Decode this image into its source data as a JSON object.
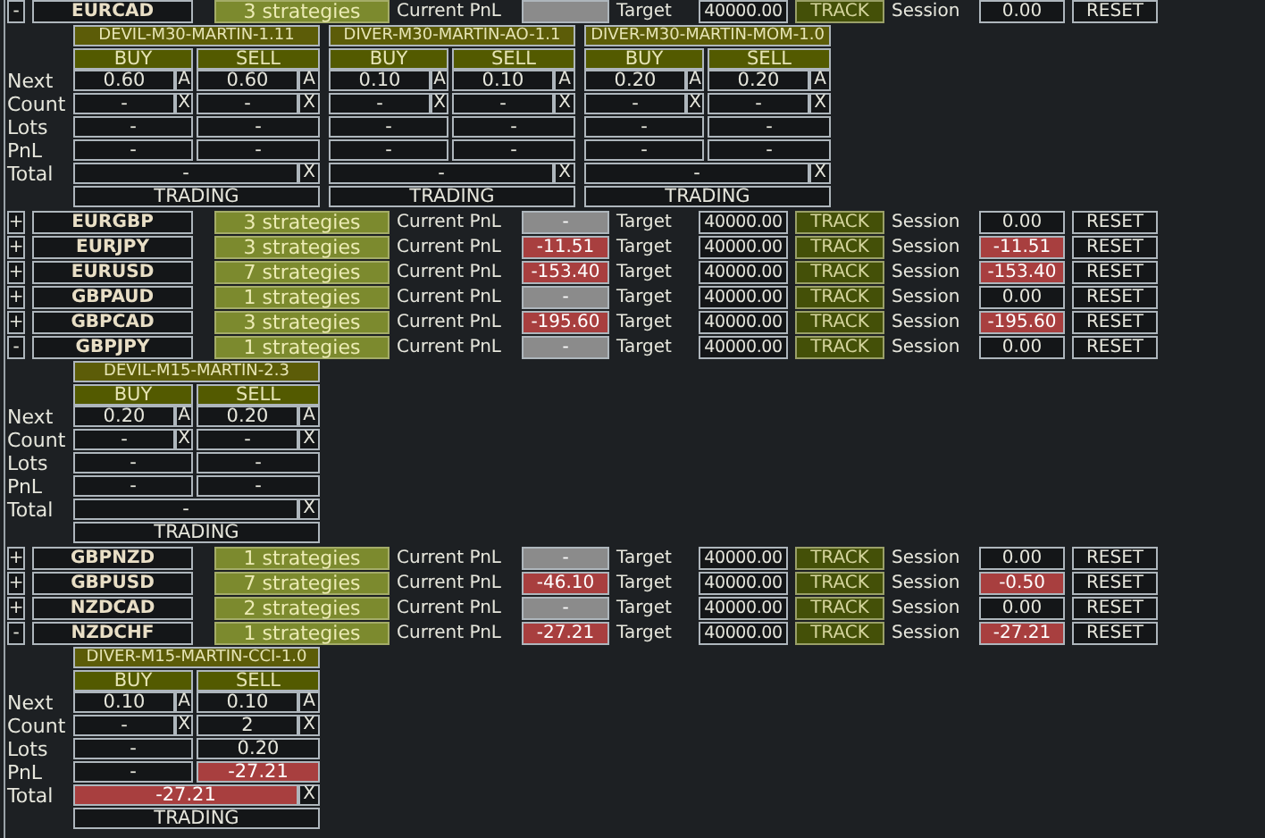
{
  "pairs": [
    {
      "toggle": "-",
      "symbol": "EURCAD",
      "strategies": "3 strategies",
      "pnl_label": "Current PnL",
      "pnl": {
        "loss": false
      },
      "target_label": "Target",
      "target": "40000.00",
      "track": "TRACK",
      "session_label": "Session",
      "session": {
        "text": "0.00",
        "loss": false
      },
      "reset": "RESET",
      "detail": {
        "row_labels": [
          "Next",
          "Count",
          "Lots",
          "PnL",
          "Total"
        ],
        "strategies": [
          {
            "name": "DEVIL-M30-MARTIN-1.11",
            "sides": [
              {
                "label": "BUY",
                "next": "0.60",
                "auto": "A",
                "count": "-",
                "close": "X",
                "lots": "-",
                "pnl": {
                  "text": "-",
                  "loss": false
                }
              },
              {
                "label": "SELL",
                "next": "0.60",
                "auto": "A",
                "count": "-",
                "close": "X",
                "lots": "-",
                "pnl": {
                  "text": "-",
                  "loss": false
                }
              }
            ],
            "total": {
              "text": "-",
              "loss": false
            },
            "total_close": "X",
            "status": "TRADING"
          },
          {
            "name": "DIVER-M30-MARTIN-AO-1.1",
            "sides": [
              {
                "label": "BUY",
                "next": "0.10",
                "auto": "A",
                "count": "-",
                "close": "X",
                "lots": "-",
                "pnl": {
                  "text": "-",
                  "loss": false
                }
              },
              {
                "label": "SELL",
                "next": "0.10",
                "auto": "A",
                "count": "-",
                "close": "X",
                "lots": "-",
                "pnl": {
                  "text": "-",
                  "loss": false
                }
              }
            ],
            "total": {
              "text": "-",
              "loss": false
            },
            "total_close": "X",
            "status": "TRADING"
          },
          {
            "name": "DIVER-M30-MARTIN-MOM-1.0",
            "sides": [
              {
                "label": "BUY",
                "next": "0.20",
                "auto": "A",
                "count": "-",
                "close": "X",
                "lots": "-",
                "pnl": {
                  "text": "-",
                  "loss": false
                }
              },
              {
                "label": "SELL",
                "next": "0.20",
                "auto": "A",
                "count": "-",
                "close": "X",
                "lots": "-",
                "pnl": {
                  "text": "-",
                  "loss": false
                }
              }
            ],
            "total": {
              "text": "-",
              "loss": false
            },
            "total_close": "X",
            "status": "TRADING"
          }
        ]
      }
    },
    {
      "toggle": "+",
      "symbol": "EURGBP",
      "strategies": "3 strategies",
      "pnl_label": "Current PnL",
      "pnl": {
        "text": "-",
        "loss": false
      },
      "target_label": "Target",
      "target": "40000.00",
      "track": "TRACK",
      "session_label": "Session",
      "session": {
        "text": "0.00",
        "loss": false
      },
      "reset": "RESET"
    },
    {
      "toggle": "+",
      "symbol": "EURJPY",
      "strategies": "3 strategies",
      "pnl_label": "Current PnL",
      "pnl": {
        "text": "-11.51",
        "loss": true
      },
      "target_label": "Target",
      "target": "40000.00",
      "track": "TRACK",
      "session_label": "Session",
      "session": {
        "text": "-11.51",
        "loss": true
      },
      "reset": "RESET"
    },
    {
      "toggle": "+",
      "symbol": "EURUSD",
      "strategies": "7 strategies",
      "pnl_label": "Current PnL",
      "pnl": {
        "text": "-153.40",
        "loss": true
      },
      "target_label": "Target",
      "target": "40000.00",
      "track": "TRACK",
      "session_label": "Session",
      "session": {
        "text": "-153.40",
        "loss": true
      },
      "reset": "RESET"
    },
    {
      "toggle": "+",
      "symbol": "GBPAUD",
      "strategies": "1 strategies",
      "pnl_label": "Current PnL",
      "pnl": {
        "text": "-",
        "loss": false
      },
      "target_label": "Target",
      "target": "40000.00",
      "track": "TRACK",
      "session_label": "Session",
      "session": {
        "text": "0.00",
        "loss": false
      },
      "reset": "RESET"
    },
    {
      "toggle": "+",
      "symbol": "GBPCAD",
      "strategies": "3 strategies",
      "pnl_label": "Current PnL",
      "pnl": {
        "text": "-195.60",
        "loss": true
      },
      "target_label": "Target",
      "target": "40000.00",
      "track": "TRACK",
      "session_label": "Session",
      "session": {
        "text": "-195.60",
        "loss": true
      },
      "reset": "RESET"
    },
    {
      "toggle": "-",
      "symbol": "GBPJPY",
      "strategies": "1 strategies",
      "pnl_label": "Current PnL",
      "pnl": {
        "text": "-",
        "loss": false
      },
      "target_label": "Target",
      "target": "40000.00",
      "track": "TRACK",
      "session_label": "Session",
      "session": {
        "text": "0.00",
        "loss": false
      },
      "reset": "RESET",
      "detail": {
        "row_labels": [
          "Next",
          "Count",
          "Lots",
          "PnL",
          "Total"
        ],
        "strategies": [
          {
            "name": "DEVIL-M15-MARTIN-2.3",
            "sides": [
              {
                "label": "BUY",
                "next": "0.20",
                "auto": "A",
                "count": "-",
                "close": "X",
                "lots": "-",
                "pnl": {
                  "text": "-",
                  "loss": false
                }
              },
              {
                "label": "SELL",
                "next": "0.20",
                "auto": "A",
                "count": "-",
                "close": "X",
                "lots": "-",
                "pnl": {
                  "text": "-",
                  "loss": false
                }
              }
            ],
            "total": {
              "text": "-",
              "loss": false
            },
            "total_close": "X",
            "status": "TRADING"
          }
        ]
      }
    },
    {
      "toggle": "+",
      "symbol": "GBPNZD",
      "strategies": "1 strategies",
      "pnl_label": "Current PnL",
      "pnl": {
        "text": "-",
        "loss": false
      },
      "target_label": "Target",
      "target": "40000.00",
      "track": "TRACK",
      "session_label": "Session",
      "session": {
        "text": "0.00",
        "loss": false
      },
      "reset": "RESET"
    },
    {
      "toggle": "+",
      "symbol": "GBPUSD",
      "strategies": "7 strategies",
      "pnl_label": "Current PnL",
      "pnl": {
        "text": "-46.10",
        "loss": true
      },
      "target_label": "Target",
      "target": "40000.00",
      "track": "TRACK",
      "session_label": "Session",
      "session": {
        "text": "-0.50",
        "loss": true
      },
      "reset": "RESET"
    },
    {
      "toggle": "+",
      "symbol": "NZDCAD",
      "strategies": "2 strategies",
      "pnl_label": "Current PnL",
      "pnl": {
        "text": "-",
        "loss": false
      },
      "target_label": "Target",
      "target": "40000.00",
      "track": "TRACK",
      "session_label": "Session",
      "session": {
        "text": "0.00",
        "loss": false
      },
      "reset": "RESET"
    },
    {
      "toggle": "-",
      "symbol": "NZDCHF",
      "strategies": "1 strategies",
      "pnl_label": "Current PnL",
      "pnl": {
        "text": "-27.21",
        "loss": true
      },
      "target_label": "Target",
      "target": "40000.00",
      "track": "TRACK",
      "session_label": "Session",
      "session": {
        "text": "-27.21",
        "loss": true
      },
      "reset": "RESET",
      "detail": {
        "row_labels": [
          "Next",
          "Count",
          "Lots",
          "PnL",
          "Total"
        ],
        "strategies": [
          {
            "name": "DIVER-M15-MARTIN-CCI-1.0",
            "sides": [
              {
                "label": "BUY",
                "next": "0.10",
                "auto": "A",
                "count": "-",
                "close": "X",
                "lots": "-",
                "pnl": {
                  "text": "-",
                  "loss": false
                }
              },
              {
                "label": "SELL",
                "next": "0.10",
                "auto": "A",
                "count": "2",
                "close": "X",
                "lots": "0.20",
                "pnl": {
                  "text": "-27.21",
                  "loss": true
                }
              }
            ],
            "total": {
              "text": "-27.21",
              "loss": true
            },
            "total_close": "X",
            "status": "TRADING"
          }
        ]
      }
    }
  ]
}
